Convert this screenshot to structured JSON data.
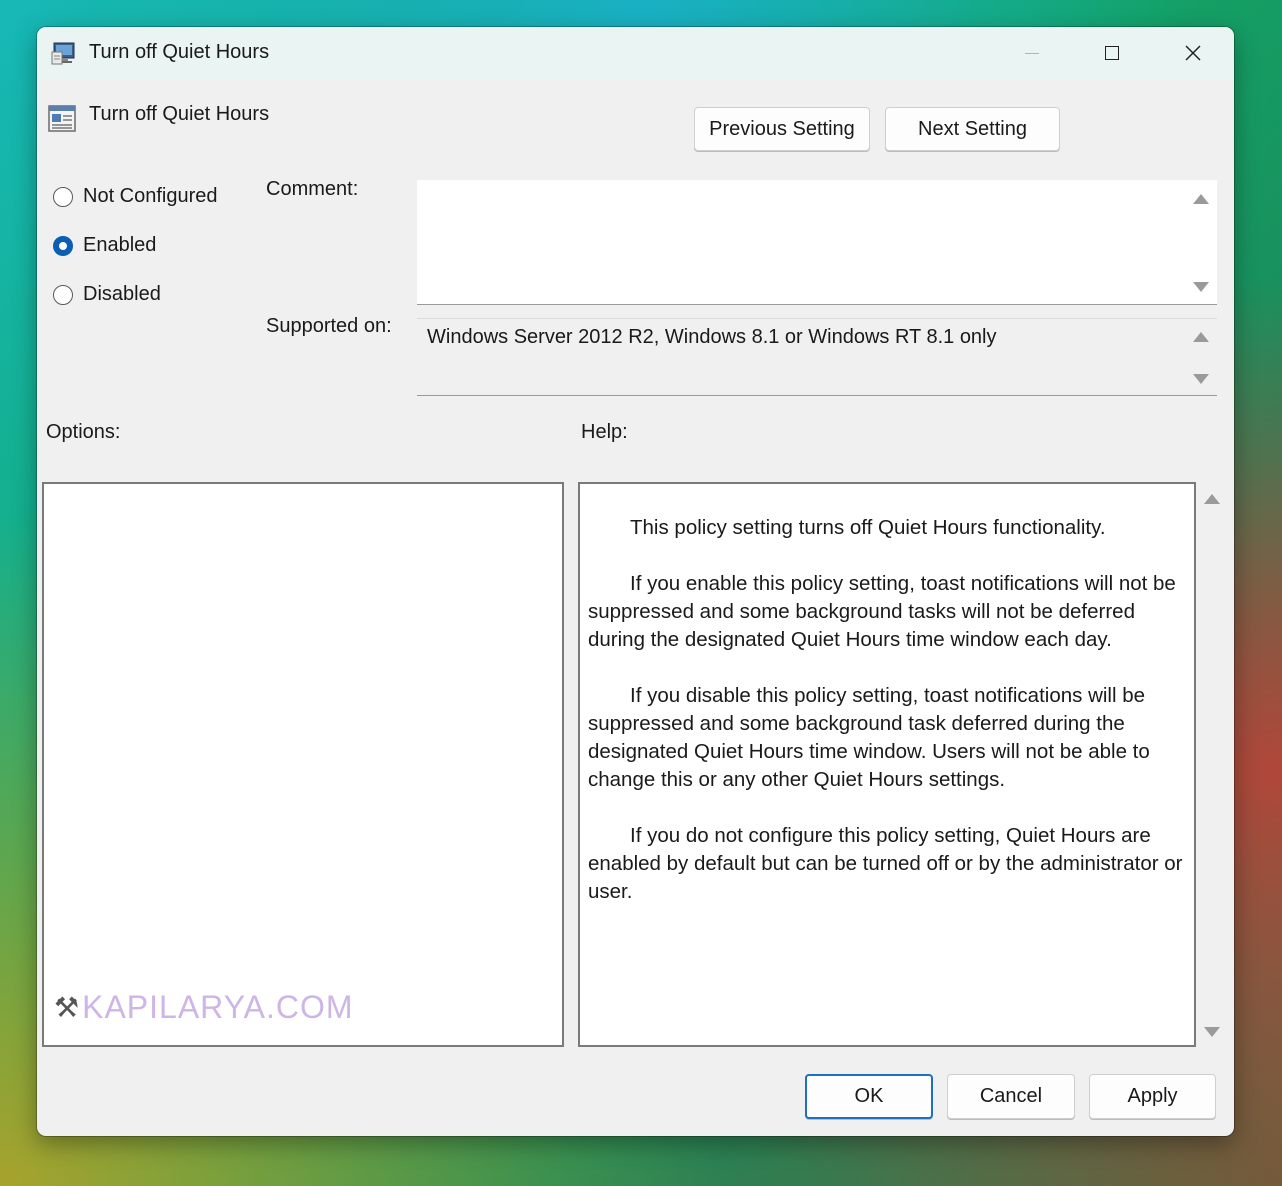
{
  "window": {
    "title": "Turn off Quiet Hours",
    "controls": [
      "minimize",
      "maximize",
      "close"
    ]
  },
  "header": {
    "policy_name": "Turn off Quiet Hours",
    "prev_label": "Previous Setting",
    "next_label": "Next Setting"
  },
  "state": {
    "options": [
      {
        "label": "Not Configured",
        "selected": false
      },
      {
        "label": "Enabled",
        "selected": true
      },
      {
        "label": "Disabled",
        "selected": false
      }
    ]
  },
  "comment": {
    "label": "Comment:",
    "value": ""
  },
  "supported": {
    "label": "Supported on:",
    "value": "Windows Server 2012 R2, Windows 8.1 or Windows RT 8.1 only"
  },
  "options_panel": {
    "label": "Options:",
    "watermark": "KAPILARYA.COM"
  },
  "help": {
    "label": "Help:",
    "paragraphs": [
      "This policy setting turns off Quiet Hours functionality.",
      "If you enable this policy setting, toast notifications will not be suppressed and some background tasks will not be deferred during the designated Quiet Hours time window each day.",
      "If you disable this policy setting, toast notifications will be suppressed and some background task deferred during the designated Quiet Hours time window.  Users will not be able to change this or any other Quiet Hours settings.",
      "If you do not configure this policy setting, Quiet Hours are enabled by default but can be turned off or by the administrator or user."
    ]
  },
  "footer": {
    "ok_label": "OK",
    "cancel_label": "Cancel",
    "apply_label": "Apply"
  },
  "colors": {
    "accent": "#0a5fb4",
    "ok_border": "#1f6fbd",
    "dialog_bg": "#f0f0f0",
    "titlebar_bg": "#eaf4f3"
  }
}
